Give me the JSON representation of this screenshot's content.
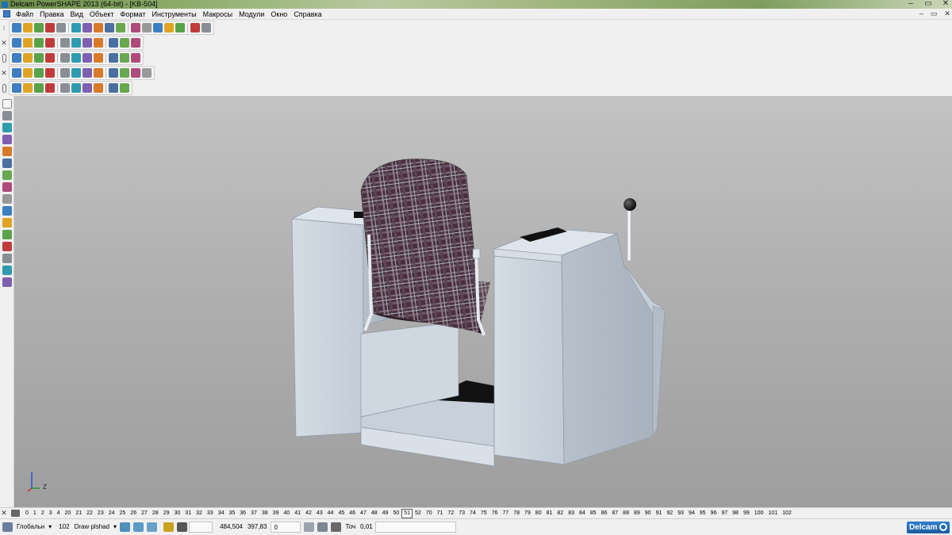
{
  "window": {
    "title": "Delcam PowerSHAPE 2013 (64-bit) - [KB-504]",
    "buttons": [
      "–",
      "▭",
      "✕"
    ]
  },
  "menu": {
    "items": [
      "Файл",
      "Правка",
      "Вид",
      "Объект",
      "Формат",
      "Инструменты",
      "Макросы",
      "Модули",
      "Окно",
      "Справка"
    ],
    "mdi_buttons": [
      "–",
      "▭",
      "✕"
    ]
  },
  "toolbars": {
    "row1_icons": [
      "new-icon",
      "open-icon",
      "save-icon",
      "print-icon",
      "cut-icon",
      "copy-icon",
      "paste-icon",
      "undo-icon",
      "redo-icon",
      "select-icon",
      "line-icon",
      "circle-icon",
      "curve-icon",
      "surface-icon",
      "solid-icon",
      "render-icon",
      "tools-icon"
    ],
    "row2_icons": [
      "view-top-icon",
      "view-front-icon",
      "view-side-icon",
      "view-iso-icon",
      "zoom-icon",
      "zoom-box-icon",
      "zoom-fit-icon",
      "sphere-icon",
      "shade-icon",
      "light-icon",
      "hand-icon"
    ],
    "row3_icons": [
      "calculator-icon",
      "doc-icon",
      "pencil-icon",
      "cube-green-icon",
      "sphere-red-icon",
      "cone-icon",
      "arrow-icon",
      "box-icon",
      "layers-icon",
      "grid-icon",
      "camera-icon"
    ],
    "row4_icons": [
      "solid-box-icon",
      "solid-cyl-icon",
      "solid-sphere-icon",
      "solid-cone-icon",
      "solid-torus-icon",
      "solid-extrude-icon",
      "solid-spin-icon",
      "solid-fillet-icon",
      "solid-chamfer-icon",
      "solid-shell-icon",
      "solid-boolean-icon",
      "solid-cut-icon"
    ],
    "row5_icons": [
      "feature-icon",
      "axis-icon",
      "block-icon",
      "fillet-icon",
      "boss-icon",
      "pocket-icon",
      "hole-icon",
      "pattern-icon",
      "draft-icon",
      "mirror-icon"
    ]
  },
  "left_toolbar": {
    "icons": [
      "pointer-icon",
      "select-filter-icon",
      "copy-icon",
      "move-icon",
      "rotate-icon",
      "scale-icon",
      "mirror-icon",
      "offset-icon",
      "trim-icon",
      "join-icon",
      "split-icon",
      "fillet-icon",
      "blend-icon",
      "project-icon",
      "surface-icon",
      "solid-icon"
    ]
  },
  "viewport": {
    "axis_label": "Z",
    "colors": {
      "cabinet": "#c9d2dc",
      "cabinet_shadow": "#a9b4bf",
      "seat_fabric": "#4a2f3a",
      "handle": "#111111",
      "pad": "#1a1a1a"
    }
  },
  "layers": {
    "list": [
      "0",
      "1",
      "2",
      "3",
      "4",
      "20",
      "21",
      "22",
      "23",
      "24",
      "25",
      "26",
      "27",
      "28",
      "29",
      "30",
      "31",
      "32",
      "33",
      "34",
      "35",
      "36",
      "37",
      "38",
      "39",
      "40",
      "41",
      "42",
      "43",
      "44",
      "45",
      "46",
      "47",
      "48",
      "49",
      "50",
      "51",
      "52",
      "70",
      "71",
      "72",
      "73",
      "74",
      "75",
      "76",
      "77",
      "78",
      "79",
      "80",
      "81",
      "82",
      "83",
      "84",
      "85",
      "86",
      "87",
      "88",
      "89",
      "90",
      "91",
      "92",
      "93",
      "94",
      "95",
      "96",
      "97",
      "98",
      "99",
      "100",
      "101",
      "102"
    ],
    "active": "51"
  },
  "status": {
    "workplane": "Глобальн",
    "level_number": "102",
    "level_name": "Draw plshad",
    "coord_x": "484,504",
    "coord_y": "397,83",
    "coord_z": "0",
    "tolerance_label": "Точ",
    "tolerance_value": "0,01",
    "brand": "Delcam"
  }
}
